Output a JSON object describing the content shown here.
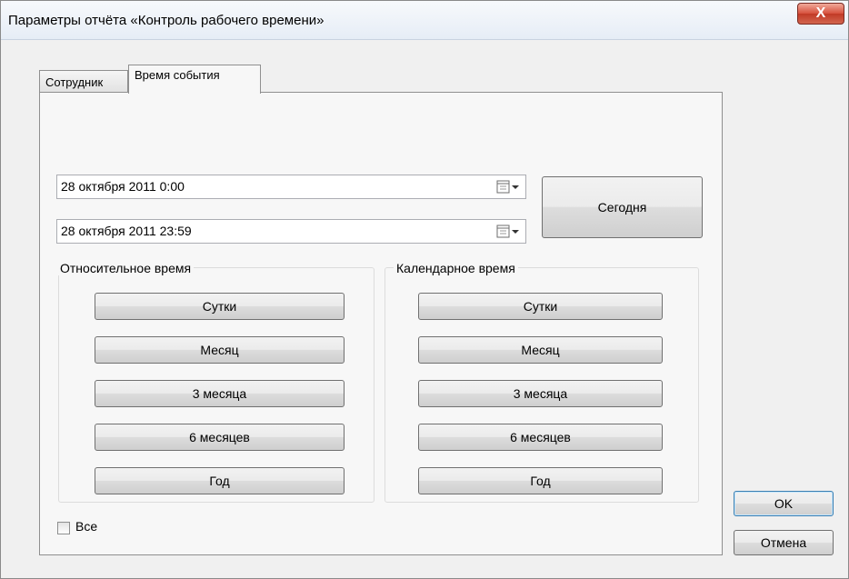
{
  "window": {
    "title": "Параметры отчёта «Контроль рабочего времени»",
    "close_label": "X"
  },
  "tabs": [
    {
      "label": "Сотрудник",
      "active": false
    },
    {
      "label": "Время события",
      "active": true
    }
  ],
  "date_from": {
    "value": "28  октября  2011   0:00"
  },
  "date_to": {
    "value": "28  октября  2011 23:59"
  },
  "today_button": "Сегодня",
  "relative_group": {
    "title": "Относительное время",
    "buttons": [
      "Сутки",
      "Месяц",
      "3 месяца",
      "6 месяцев",
      "Год"
    ]
  },
  "calendar_group": {
    "title": "Календарное время",
    "buttons": [
      "Сутки",
      "Месяц",
      "3 месяца",
      "6 месяцев",
      "Год"
    ]
  },
  "all_checkbox": {
    "label": "Все",
    "checked": false
  },
  "ok_button": "OK",
  "cancel_button": "Отмена",
  "colors": {
    "close_button": "#c13a26",
    "default_button_border": "#3c7fb1"
  },
  "icons": {
    "date_picker": "calendar-dropdown-icon"
  }
}
